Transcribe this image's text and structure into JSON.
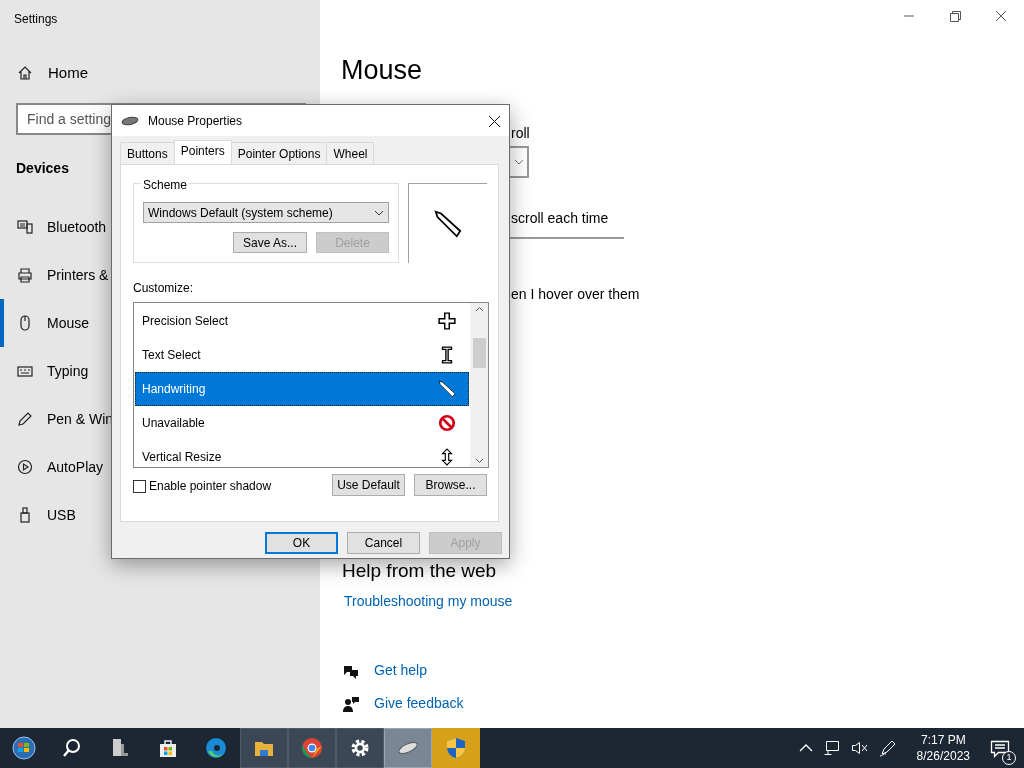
{
  "settings": {
    "title": "Settings",
    "home": {
      "label": "Home"
    },
    "search": {
      "placeholder": "Find a setting"
    },
    "section": "Devices",
    "nav": [
      {
        "label": "Bluetooth",
        "selected": false
      },
      {
        "label": "Printers &",
        "selected": false
      },
      {
        "label": "Mouse",
        "selected": true
      },
      {
        "label": "Typing",
        "selected": false
      },
      {
        "label": "Pen & Win",
        "selected": false
      },
      {
        "label": "AutoPlay",
        "selected": false
      },
      {
        "label": "USB",
        "selected": false
      }
    ],
    "page": {
      "title": "Mouse",
      "fragments": [
        "roll",
        "scroll each time",
        "en I hover over them"
      ],
      "help_heading": "Help from the web",
      "help_link": "Troubleshooting my mouse",
      "footer_links": [
        "Get help",
        "Give feedback"
      ]
    }
  },
  "dialog": {
    "title": "Mouse Properties",
    "tabs": [
      {
        "label": "Buttons",
        "selected": false
      },
      {
        "label": "Pointers",
        "selected": true
      },
      {
        "label": "Pointer Options",
        "selected": false
      },
      {
        "label": "Wheel",
        "selected": false
      }
    ],
    "scheme": {
      "label": "Scheme",
      "value": "Windows Default (system scheme)",
      "buttons": [
        {
          "label": "Save As...",
          "disabled": false
        },
        {
          "label": "Delete",
          "disabled": true
        }
      ]
    },
    "customize_label": "Customize:",
    "pointers": [
      {
        "label": "Precision Select",
        "kind": "precision",
        "selected": false
      },
      {
        "label": "Text Select",
        "kind": "text",
        "selected": false
      },
      {
        "label": "Handwriting",
        "kind": "pen",
        "selected": true
      },
      {
        "label": "Unavailable",
        "kind": "unavailable",
        "selected": false
      },
      {
        "label": "Vertical Resize",
        "kind": "vresize",
        "selected": false
      }
    ],
    "shadow": {
      "label": "Enable pointer shadow",
      "checked": false
    },
    "list_buttons": [
      "Use Default",
      "Browse..."
    ],
    "buttons": [
      {
        "label": "OK",
        "default": true,
        "disabled": false
      },
      {
        "label": "Cancel",
        "default": false,
        "disabled": false
      },
      {
        "label": "Apply",
        "default": false,
        "disabled": true
      }
    ]
  },
  "taskbar": {
    "apps": [
      {
        "kind": "start",
        "open": false,
        "active": false,
        "flashing": false
      },
      {
        "kind": "search",
        "open": false,
        "active": false,
        "flashing": false
      },
      {
        "kind": "taskview",
        "open": false,
        "active": false,
        "flashing": false
      },
      {
        "kind": "store",
        "open": false,
        "active": false,
        "flashing": false
      },
      {
        "kind": "edge",
        "open": false,
        "active": false,
        "flashing": false
      },
      {
        "kind": "folder",
        "open": true,
        "active": false,
        "flashing": false
      },
      {
        "kind": "chrome",
        "open": true,
        "active": false,
        "flashing": false
      },
      {
        "kind": "gear",
        "open": true,
        "active": false,
        "flashing": false
      },
      {
        "kind": "mouse",
        "open": true,
        "active": true,
        "flashing": false
      },
      {
        "kind": "shield",
        "open": true,
        "active": false,
        "flashing": true
      }
    ],
    "time": "7:17 PM",
    "date": "8/26/2023",
    "notifications": "1"
  }
}
